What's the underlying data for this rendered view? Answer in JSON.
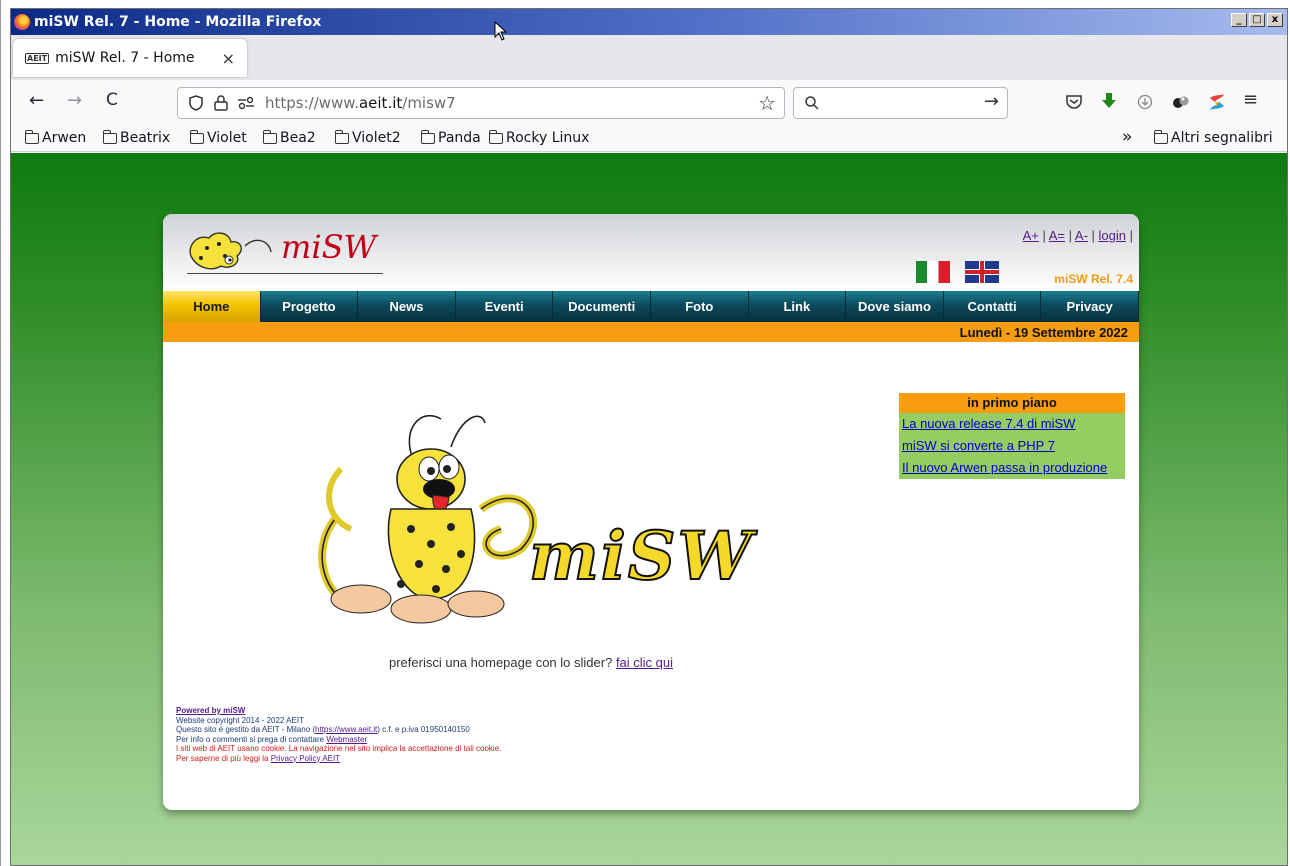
{
  "window": {
    "title": "miSW Rel. 7 - Home - Mozilla Firefox",
    "min": "_",
    "max": "□",
    "close": "x"
  },
  "tab": {
    "favicon": "AEIT",
    "title": "miSW Rel. 7 - Home",
    "close": "×"
  },
  "nav": {
    "back": "←",
    "forward": "→",
    "reload": "C",
    "url_prefix": "https://www.",
    "url_host": "aeit.it",
    "url_path": "/misw7",
    "star": "☆",
    "search_icon": "🔍",
    "go": "→"
  },
  "bookmarks": [
    "Arwen",
    "Beatrix",
    "Violet",
    "Bea2",
    "Violet2",
    "Panda",
    "Rocky Linux"
  ],
  "bookmarks_more": "»",
  "bookmarks_other": "Altri segnalibri",
  "site": {
    "logo_text": "miSW",
    "a_plus": "A+",
    "a_eq": "A=",
    "a_minus": "A-",
    "login": "login",
    "release": "miSW Rel. 7.4",
    "menu": [
      "Home",
      "Progetto",
      "News",
      "Eventi",
      "Documenti",
      "Foto",
      "Link",
      "Dove siamo",
      "Contatti",
      "Privacy"
    ],
    "date": "Lunedì - 19 Settembre 2022",
    "mascot_text": "miSW",
    "slider_note": "preferisci una homepage con lo slider?",
    "slider_link": "fai clic qui",
    "news_title": "in primo piano",
    "news": [
      "La nuova release 7.4 di miSW",
      "miSW si converte a PHP 7",
      "Il nuovo Arwen passa in produzione"
    ],
    "footer": {
      "powered": "Powered by miSW",
      "copyright": "Website copyright 2014 - 2022 AEIT",
      "managed_pre": "Questo sito è gestito da AEIT - Milano (",
      "managed_link": "https://www.aeit.it",
      "managed_post": ") c.f. e p.iva 01950140150",
      "info_pre": "Per info o commenti si prega di contattare",
      "info_link": "Webmaster",
      "cookie": "I siti web di AEIT usano cookie. La navigazione nel sito implica la accettazione di tali cookie.",
      "privacy_pre": "Per saperne di più leggi la",
      "privacy_link": "Privacy Policy AEIT"
    }
  }
}
